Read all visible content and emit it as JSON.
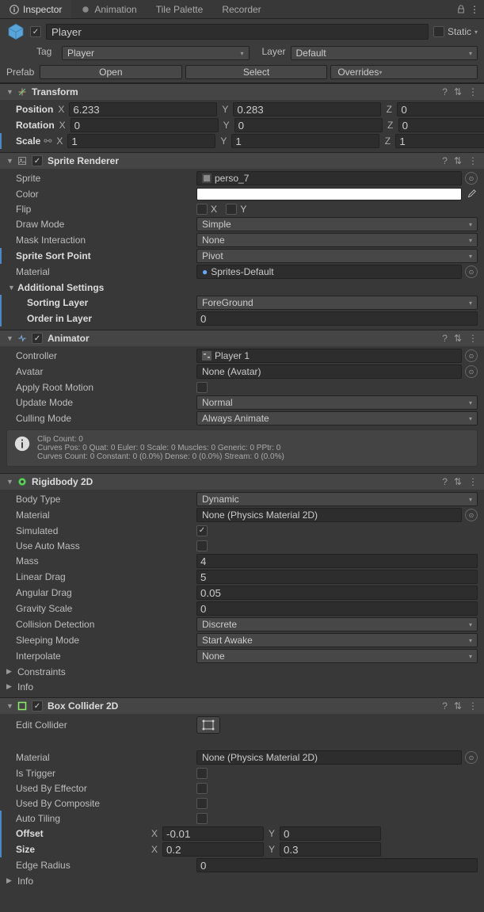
{
  "tabs": {
    "inspector": "Inspector",
    "animation": "Animation",
    "tilepalette": "Tile Palette",
    "recorder": "Recorder"
  },
  "header": {
    "name": "Player",
    "static": "Static",
    "tag_label": "Tag",
    "tag_value": "Player",
    "layer_label": "Layer",
    "layer_value": "Default"
  },
  "prefab": {
    "label": "Prefab",
    "open": "Open",
    "select": "Select",
    "overrides": "Overrides"
  },
  "transform": {
    "title": "Transform",
    "position": {
      "label": "Position",
      "x": "6.233",
      "y": "0.283",
      "z": "0"
    },
    "rotation": {
      "label": "Rotation",
      "x": "0",
      "y": "0",
      "z": "0"
    },
    "scale": {
      "label": "Scale",
      "x": "1",
      "y": "1",
      "z": "1"
    }
  },
  "spriteRenderer": {
    "title": "Sprite Renderer",
    "sprite": {
      "label": "Sprite",
      "value": "perso_7"
    },
    "color": {
      "label": "Color",
      "value": "#ffffff"
    },
    "flip": {
      "label": "Flip",
      "x": false,
      "y": false
    },
    "drawMode": {
      "label": "Draw Mode",
      "value": "Simple"
    },
    "maskInteraction": {
      "label": "Mask Interaction",
      "value": "None"
    },
    "spriteSortPoint": {
      "label": "Sprite Sort Point",
      "value": "Pivot"
    },
    "material": {
      "label": "Material",
      "value": "Sprites-Default"
    },
    "additional": {
      "label": "Additional Settings"
    },
    "sortingLayer": {
      "label": "Sorting Layer",
      "value": "ForeGround"
    },
    "orderInLayer": {
      "label": "Order in Layer",
      "value": "0"
    }
  },
  "animator": {
    "title": "Animator",
    "controller": {
      "label": "Controller",
      "value": "Player 1"
    },
    "avatar": {
      "label": "Avatar",
      "value": "None (Avatar)"
    },
    "applyRootMotion": {
      "label": "Apply Root Motion",
      "value": false
    },
    "updateMode": {
      "label": "Update Mode",
      "value": "Normal"
    },
    "cullingMode": {
      "label": "Culling Mode",
      "value": "Always Animate"
    },
    "info": {
      "line1": "Clip Count: 0",
      "line2": "Curves Pos: 0 Quat: 0 Euler: 0 Scale: 0 Muscles: 0 Generic: 0 PPtr: 0",
      "line3": "Curves Count: 0 Constant: 0 (0.0%) Dense: 0 (0.0%) Stream: 0 (0.0%)"
    }
  },
  "rigidbody": {
    "title": "Rigidbody 2D",
    "bodyType": {
      "label": "Body Type",
      "value": "Dynamic"
    },
    "material": {
      "label": "Material",
      "value": "None (Physics Material 2D)"
    },
    "simulated": {
      "label": "Simulated",
      "value": true
    },
    "useAutoMass": {
      "label": "Use Auto Mass",
      "value": false
    },
    "mass": {
      "label": "Mass",
      "value": "4"
    },
    "linearDrag": {
      "label": "Linear Drag",
      "value": "5"
    },
    "angularDrag": {
      "label": "Angular Drag",
      "value": "0.05"
    },
    "gravityScale": {
      "label": "Gravity Scale",
      "value": "0"
    },
    "collisionDetection": {
      "label": "Collision Detection",
      "value": "Discrete"
    },
    "sleepingMode": {
      "label": "Sleeping Mode",
      "value": "Start Awake"
    },
    "interpolate": {
      "label": "Interpolate",
      "value": "None"
    },
    "constraints": "Constraints",
    "info": "Info"
  },
  "boxCollider": {
    "title": "Box Collider 2D",
    "editCollider": {
      "label": "Edit Collider"
    },
    "material": {
      "label": "Material",
      "value": "None (Physics Material 2D)"
    },
    "isTrigger": {
      "label": "Is Trigger",
      "value": false
    },
    "usedByEffector": {
      "label": "Used By Effector",
      "value": false
    },
    "usedByComposite": {
      "label": "Used By Composite",
      "value": false
    },
    "autoTiling": {
      "label": "Auto Tiling",
      "value": false
    },
    "offset": {
      "label": "Offset",
      "x": "-0.01",
      "y": "0"
    },
    "size": {
      "label": "Size",
      "x": "0.2",
      "y": "0.3"
    },
    "edgeRadius": {
      "label": "Edge Radius",
      "value": "0"
    },
    "info": "Info"
  },
  "axis": {
    "x": "X",
    "y": "Y",
    "z": "Z"
  },
  "glyph": {
    "check": "✓",
    "help": "?",
    "kebab": "⋮",
    "lock": "🔓",
    "preset": "⇄",
    "link": "⚯"
  }
}
